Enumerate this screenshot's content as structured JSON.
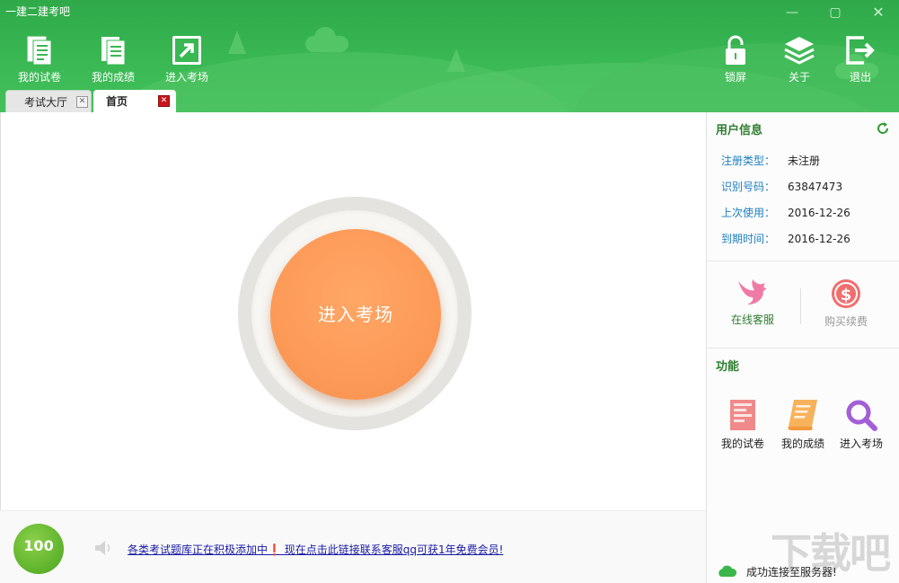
{
  "app": {
    "title": "一建二建考吧",
    "window_controls": {
      "minimize": "—",
      "maximize": "▢",
      "close": "✕"
    }
  },
  "toolbar": {
    "left_items": [
      {
        "label": "我的试卷",
        "icon": "document-icon"
      },
      {
        "label": "我的成绩",
        "icon": "report-icon"
      },
      {
        "label": "进入考场",
        "icon": "enter-arrow-icon"
      }
    ],
    "right_items": [
      {
        "label": "锁屏",
        "icon": "lock-icon"
      },
      {
        "label": "关于",
        "icon": "layers-icon"
      },
      {
        "label": "退出",
        "icon": "exit-icon"
      }
    ]
  },
  "tabs": [
    {
      "label": "考试大厅",
      "active": false,
      "close": "✕"
    },
    {
      "label": "首页",
      "active": true,
      "close": "✕"
    }
  ],
  "main": {
    "start_button": "进入考场"
  },
  "footer": {
    "logo_text": "100",
    "notice": "各类考试题库正在积极添加中❗ 现在点击此链接联系客服qq可获1年免费会员!"
  },
  "side": {
    "user_info_title": "用户信息",
    "user_info": [
      {
        "key": "注册类型：",
        "value": "未注册"
      },
      {
        "key": "识别号码：",
        "value": "63847473"
      },
      {
        "key": "上次使用：",
        "value": "2016-12-26"
      },
      {
        "key": "到期时间：",
        "value": "2016-12-26"
      }
    ],
    "service_button": "在线客服",
    "buy_button": "购买续费",
    "functions_title": "功能",
    "functions": [
      {
        "label": "我的试卷",
        "icon": "paper-icon"
      },
      {
        "label": "我的成绩",
        "icon": "score-icon"
      },
      {
        "label": "进入考场",
        "icon": "magnifier-icon"
      }
    ],
    "status": "成功连接至服务器!"
  },
  "watermark": "下载吧",
  "colors": {
    "header_green": "#39b853",
    "orange_button": "#fd9a58",
    "section_title": "#2d7e2f",
    "info_key": "#1e7fbf",
    "link_blue": "#1a1aa6"
  }
}
